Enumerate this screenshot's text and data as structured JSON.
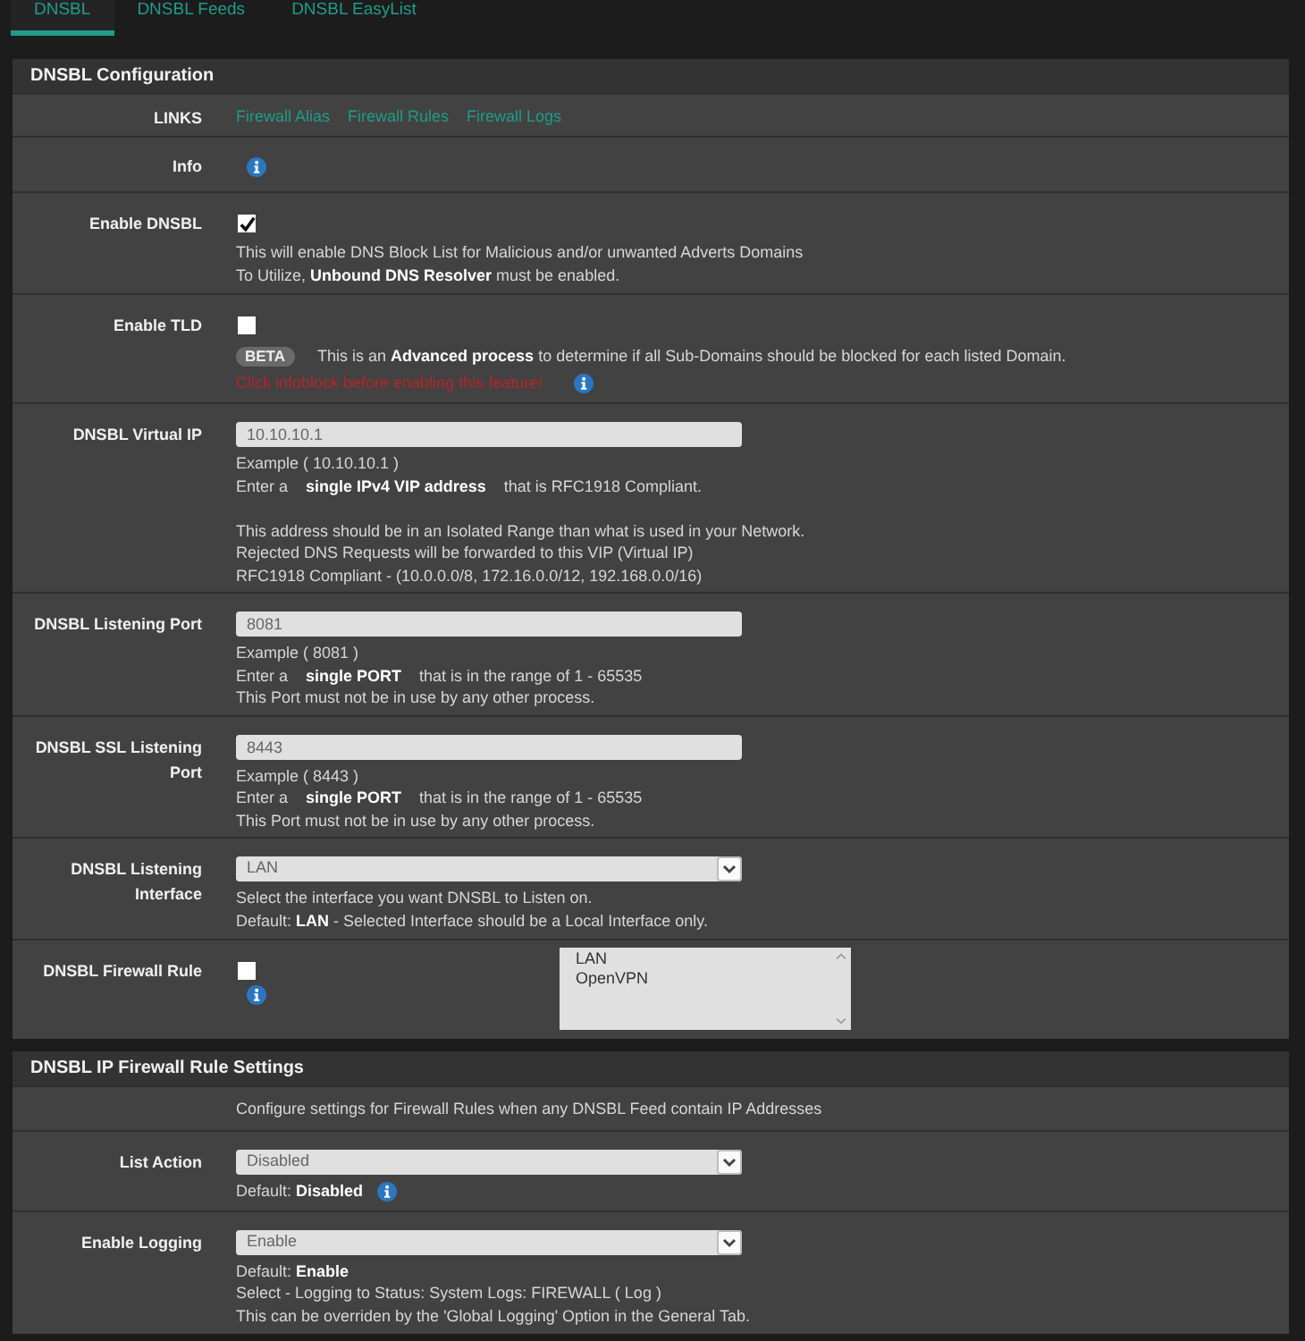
{
  "tabs": [
    {
      "label": "DNSBL",
      "selected": true
    },
    {
      "label": "DNSBL Feeds",
      "selected": false
    },
    {
      "label": "DNSBL EasyList",
      "selected": false
    }
  ],
  "panels": [
    {
      "title": "DNSBL Configuration",
      "rows": [
        {
          "kind": "links",
          "label": "LINKS",
          "links": [
            "Firewall Alias",
            "Firewall Rules",
            "Firewall Logs"
          ]
        },
        {
          "kind": "info",
          "label": "Info"
        },
        {
          "kind": "checkbox",
          "label": "Enable DNSBL",
          "checked": true,
          "help": [
            {
              "kind": "plain",
              "text": "This will enable DNS Block List for Malicious and/or unwanted Adverts Domains"
            },
            {
              "kind": "plain",
              "text": "To Utilize, **Unbound DNS Resolver** must be enabled."
            }
          ]
        },
        {
          "kind": "checkbox",
          "label": "Enable TLD",
          "checked": false,
          "help": [
            {
              "kind": "badged",
              "badge": "BETA",
              "text": "This is an **Advanced process** to determine if all Sub-Domains should be blocked for each listed Domain."
            },
            {
              "kind": "warning",
              "text": "Click infoblock before enabling this feature!",
              "info_icon": true
            }
          ]
        },
        {
          "kind": "input",
          "label": "DNSBL Virtual IP",
          "value": "10.10.10.1",
          "help": [
            {
              "kind": "plain",
              "text": "Example ( 10.10.10.1 )"
            },
            {
              "kind": "plain",
              "text": "Enter a    **single IPv4 VIP address**    that is RFC1918 Compliant."
            },
            {
              "kind": "plain",
              "text": "This address should be in an Isolated Range than what is used in your Network.",
              "gap_before": true
            },
            {
              "kind": "plain",
              "text": "Rejected DNS Requests will be forwarded to this VIP (Virtual IP)"
            },
            {
              "kind": "plain",
              "text": "RFC1918 Compliant - (10.0.0.0/8, 172.16.0.0/12, 192.168.0.0/16)"
            }
          ]
        },
        {
          "kind": "input",
          "label": "DNSBL Listening Port",
          "value": "8081",
          "help": [
            {
              "kind": "plain",
              "text": "Example ( 8081 )"
            },
            {
              "kind": "plain",
              "text": "Enter a    **single PORT**    that is in the range of 1 - 65535"
            },
            {
              "kind": "plain",
              "text": "This Port must not be in use by any other process."
            }
          ]
        },
        {
          "kind": "input",
          "label": "DNSBL SSL Listening Port",
          "value": "8443",
          "help": [
            {
              "kind": "plain",
              "text": "Example ( 8443 )"
            },
            {
              "kind": "plain",
              "text": "Enter a    **single PORT**    that is in the range of 1 - 65535"
            },
            {
              "kind": "plain",
              "text": "This Port must not be in use by any other process."
            }
          ]
        },
        {
          "kind": "select",
          "label": "DNSBL Listening Interface",
          "value": "LAN",
          "help": [
            {
              "kind": "plain",
              "text": "Select the interface you want DNSBL to Listen on."
            },
            {
              "kind": "plain",
              "text": "Default: **LAN** - Selected Interface should be a Local Interface only."
            }
          ]
        },
        {
          "kind": "checkbox_list",
          "label": "DNSBL Firewall Rule",
          "checked": false,
          "info_icon": true,
          "options": [
            {
              "label": "LAN",
              "selected": false
            },
            {
              "label": "OpenVPN",
              "selected": false
            }
          ]
        }
      ]
    },
    {
      "title": "DNSBL IP Firewall Rule Settings",
      "rows": [
        {
          "kind": "text",
          "text": "Configure settings for Firewall Rules when any DNSBL Feed contain IP Addresses"
        },
        {
          "kind": "select",
          "label": "List Action",
          "value": "Disabled",
          "help": [
            {
              "kind": "plain",
              "text": "Default: **Disabled**",
              "info_icon": true
            }
          ]
        },
        {
          "kind": "select",
          "label": "Enable Logging",
          "value": "Enable",
          "help": [
            {
              "kind": "plain",
              "text": "Default: **Enable**"
            },
            {
              "kind": "plain",
              "text": "Select - Logging to Status: System Logs: FIREWALL ( Log )"
            },
            {
              "kind": "plain",
              "text": "This can be overriden by the 'Global Logging' Option in the General Tab."
            }
          ]
        }
      ]
    }
  ]
}
